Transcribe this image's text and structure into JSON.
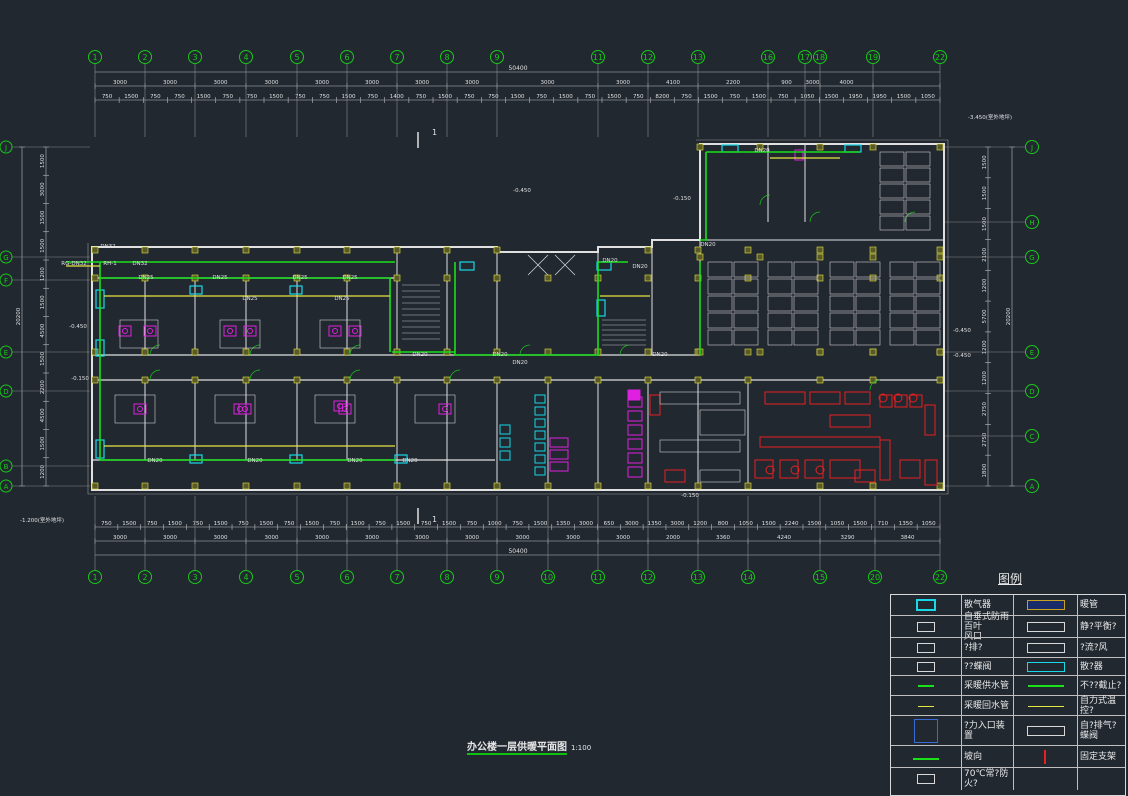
{
  "drawing_title": "办公楼一层供暖平面图",
  "drawing_scale": "1:100",
  "grid_top": [
    "1",
    "2",
    "3",
    "4",
    "5",
    "6",
    "7",
    "8",
    "9",
    "11",
    "12",
    "13",
    "16",
    "17",
    "18",
    "19",
    "22"
  ],
  "grid_bottom": [
    "1",
    "2",
    "3",
    "4",
    "5",
    "6",
    "7",
    "8",
    "9",
    "10",
    "11",
    "12",
    "13",
    "14",
    "15",
    "20",
    "22"
  ],
  "grid_rows_left": [
    "J",
    "G",
    "F",
    "E",
    "D",
    "B",
    "A"
  ],
  "grid_rows_right": [
    "J",
    "H",
    "G",
    "E",
    "D",
    "C",
    "A"
  ],
  "dim_total": "50400",
  "dim_top_bays": [
    "3000",
    "3000",
    "3000",
    "3000",
    "3000",
    "3000",
    "3000",
    "3000",
    "3000",
    "3000",
    "4100",
    "2200",
    "900",
    "3000",
    "4000"
  ],
  "dim_top_sub": [
    "750",
    "1500",
    "750",
    "750",
    "1500",
    "750",
    "750",
    "1500",
    "750",
    "750",
    "1500",
    "750",
    "1400",
    "750",
    "1500",
    "750",
    "750",
    "1500",
    "750",
    "1500",
    "750",
    "1500",
    "750",
    "8200",
    "750",
    "1500",
    "750",
    "1500",
    "750",
    "1050",
    "1500",
    "1950",
    "1950",
    "1500",
    "1050"
  ],
  "dim_bottom_bays": [
    "3000",
    "3000",
    "3000",
    "3000",
    "3000",
    "3000",
    "3000",
    "3000",
    "3000",
    "3000",
    "3000",
    "2000",
    "3360",
    "4240",
    "3290",
    "3840"
  ],
  "dim_bottom_sub": [
    "750",
    "1500",
    "750",
    "1500",
    "750",
    "1500",
    "750",
    "1500",
    "750",
    "1500",
    "750",
    "1500",
    "750",
    "1500",
    "750",
    "1500",
    "750",
    "1000",
    "750",
    "1500",
    "1350",
    "3000",
    "650",
    "3000",
    "1350",
    "3000",
    "1200",
    "800",
    "1050",
    "1500",
    "2240",
    "1500",
    "1050",
    "1500",
    "710",
    "1350",
    "1050"
  ],
  "dim_left": [
    "1500",
    "3000",
    "1500",
    "1500",
    "1200",
    "1500",
    "4500",
    "1500",
    "2200",
    "4500",
    "1500",
    "1200"
  ],
  "dim_left_total": "20200",
  "dim_right": [
    "1500",
    "1500",
    "1500",
    "2100",
    "1200",
    "5700",
    "1200",
    "1200",
    "2750",
    "2750",
    "1800"
  ],
  "dim_right_total": "20200",
  "elev_labels": [
    "-0.450",
    "-0.450",
    "-0.450",
    "-0.450",
    "-0.150",
    "-0.150",
    "-0.150",
    "-1.200(室外地坪)",
    "-3.450(室外地坪)"
  ],
  "pipe_labels": [
    "DN32",
    "DN32",
    "RG-DN32",
    "RH-1",
    "DN25",
    "DN25",
    "DN25",
    "DN25",
    "DN25",
    "DN25",
    "DN20",
    "DN20",
    "DN20",
    "DN20",
    "DN20",
    "DN20",
    "DN20",
    "DN20",
    "DN20",
    "DN20",
    "DN20",
    "DN20"
  ],
  "section_mark": "1",
  "legend": {
    "title": "图例",
    "rows": [
      {
        "n1": "散气器",
        "n2": "暖管"
      },
      {
        "n1": "自垂式防雨百叶\n风口",
        "n2": "静?平衡?"
      },
      {
        "n1": "?排?",
        "n2": "?流?风"
      },
      {
        "n1": "??蝶阀",
        "n2": "散?器"
      },
      {
        "n1": "采暖供水管",
        "n2": "不??截止?"
      },
      {
        "n1": "采暖回水管",
        "n2": "自力式温控?"
      },
      {
        "n1": "?力入口装置",
        "n2": "自?排气?\n蝶阀"
      },
      {
        "n1": "坡向",
        "n2": "固定支架"
      },
      {
        "n1": "70℃常?防火?",
        "n2": ""
      }
    ],
    "row_heights": [
      20,
      22,
      20,
      18,
      20,
      20,
      30,
      22,
      22
    ]
  },
  "colors": {
    "background": "#212830",
    "grid": "#19c819",
    "wall": "#e0e0e0",
    "supply_pipe": "#19e019",
    "return_pipe": "#e6e640",
    "radiator": "#18d8e8",
    "fixture": "#e020e0",
    "kitchen": "#e82020",
    "column": "#e6e640",
    "text": "#e8e8e8"
  }
}
